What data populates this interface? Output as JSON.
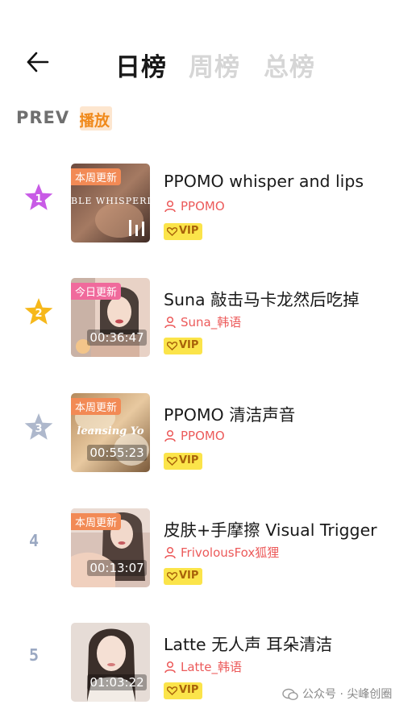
{
  "header": {
    "tabs": [
      {
        "label": "日榜",
        "active": true
      },
      {
        "label": "周榜",
        "active": false
      },
      {
        "label": "总榜",
        "active": false
      }
    ]
  },
  "prev": {
    "label": "PREV",
    "play_label": "播放"
  },
  "items": [
    {
      "rank": "1",
      "badge": "本周更新",
      "thumb_text": "BLE WHISPERING",
      "duration": "",
      "title": "PPOMO whisper and lips",
      "author": "PPOMO",
      "vip": "VIP"
    },
    {
      "rank": "2",
      "badge": "今日更新",
      "thumb_text": "",
      "duration": "00:36:47",
      "title": "Suna 敲击马卡龙然后吃掉",
      "author": "Suna_韩语",
      "vip": "VIP"
    },
    {
      "rank": "3",
      "badge": "本周更新",
      "thumb_text": "leansing Yo",
      "duration": "00:55:23",
      "title": "PPOMO 清洁声音",
      "author": "PPOMO",
      "vip": "VIP"
    },
    {
      "rank": "4",
      "badge": "本周更新",
      "thumb_text": "",
      "duration": "00:13:07",
      "title": "皮肤+手摩擦 Visual Trigger",
      "author": "FrivolousFox狐狸",
      "vip": "VIP"
    },
    {
      "rank": "5",
      "badge": "",
      "thumb_text": "",
      "duration": "01:03:22",
      "title": "Latte 无人声 耳朵清洁",
      "author": "Latte_韩语",
      "vip": "VIP"
    }
  ],
  "watermark": "公众号 · 尖峰创圈",
  "colors": {
    "rank1": "#c85be6",
    "rank2": "#f6b81b",
    "rank3": "#aeb8cc",
    "author": "#ec5a5a",
    "vip_bg": "#fbe44a"
  }
}
